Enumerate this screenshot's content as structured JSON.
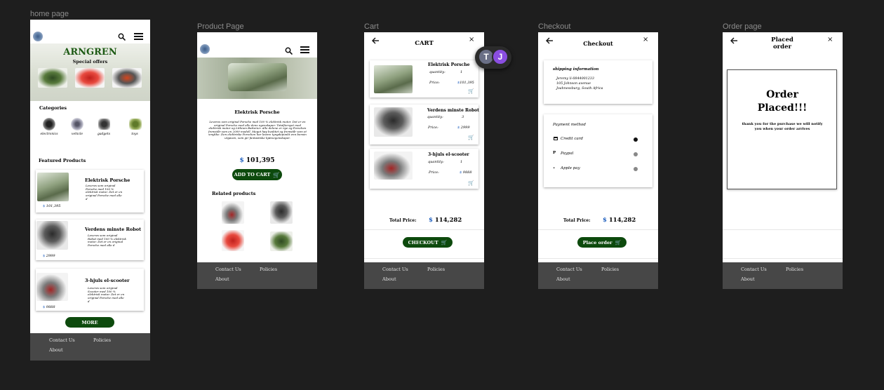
{
  "frames": {
    "home": "home page",
    "product": "Product Page",
    "cart": "Cart",
    "checkout": "Checkout",
    "order": "Order page"
  },
  "footer": {
    "contact": "Contact Us",
    "policies": "Policies",
    "about": "About"
  },
  "home": {
    "brand": "ARNGREN",
    "special": "Special offers",
    "categories_title": "Categories",
    "categories": [
      "electronics",
      "vehicle",
      "gadgets",
      "toys"
    ],
    "featured_title": "Featured Products",
    "products": [
      {
        "name": "Elektrisk Porsche",
        "desc": "Leveres som original Porsche med 100 % elektrisk motor. Det er en original Porsche med alle d",
        "currency": "$",
        "price": "101,395"
      },
      {
        "name": "Verdens minste Robot",
        "desc": "Leveres som original Robot med 100 % elektrisk motor. Det er en original Porsche med alle d",
        "currency": "$",
        "price": "2999"
      },
      {
        "name": "3-hjuls el-scooter",
        "desc": "Leveres som original Scooter med 100 % elektrisk motor. Det er en original Porsche med alle d",
        "currency": "$",
        "price": "9888"
      }
    ],
    "more": "MORE"
  },
  "product": {
    "title": "Elektrisk Porsche",
    "desc": "Leveres som original Porsche med 100 % elektrisk motor. Det er en original Porsche med alle dens egenskaper. Totalfornyet med elektrisk motor og Lithium Batterier. Alle delene er nye og Porschen fremstår som en 2009 modell. Meget høy kvalitet og fremstår som et smykke. Den elektriske Porschen har lavere tyngdepunkt enn bensin utgaven, som gir fantastiske kjøreegenskaper.",
    "currency": "$",
    "price": "101,395",
    "add_to_cart": "ADD TO CART",
    "related_title": "Related products"
  },
  "cart": {
    "title": "CART",
    "items": [
      {
        "name": "Elektrisk Porsche",
        "qty_label": "quantity:",
        "qty": "1",
        "price_label": "Price:",
        "currency": "$",
        "price": "101,395"
      },
      {
        "name": "Verdens minste Robot",
        "qty_label": "quantity:",
        "qty": "3",
        "price_label": "Price:",
        "currency": "$",
        "price": "2999"
      },
      {
        "name": "3-hjuls el-scooter",
        "qty_label": "quantity:",
        "qty": "1",
        "price_label": "Price:",
        "currency": "$",
        "price": "9888"
      }
    ],
    "total_label": "Total Price:",
    "total_currency": "$",
    "total": "114,282",
    "checkout": "CHECKOUT"
  },
  "checkout": {
    "title": "Checkout",
    "shipping_title": "shipping information",
    "shipping_lines": [
      "Jeremy li-0844001233",
      "105 Johnson avenue",
      "Joahnessburg, South Africa"
    ],
    "payment_title": "Payment method",
    "methods": [
      "Credit card",
      "Paypal",
      "Apple pay"
    ],
    "total_label": "Total Price:",
    "total_currency": "$",
    "total": "114,282",
    "place_order": "Place order"
  },
  "order": {
    "title": "Placed order",
    "big": "Order Placed!!!",
    "msg": "thank you for the purchase we will notify you when your order arrives"
  },
  "collaborators": [
    "T",
    "J"
  ],
  "colors": {
    "accent_green": "#0d4a0d",
    "price_blue": "#1f5fbf",
    "footer": "#474747",
    "canvas": "#1e1e1e"
  }
}
